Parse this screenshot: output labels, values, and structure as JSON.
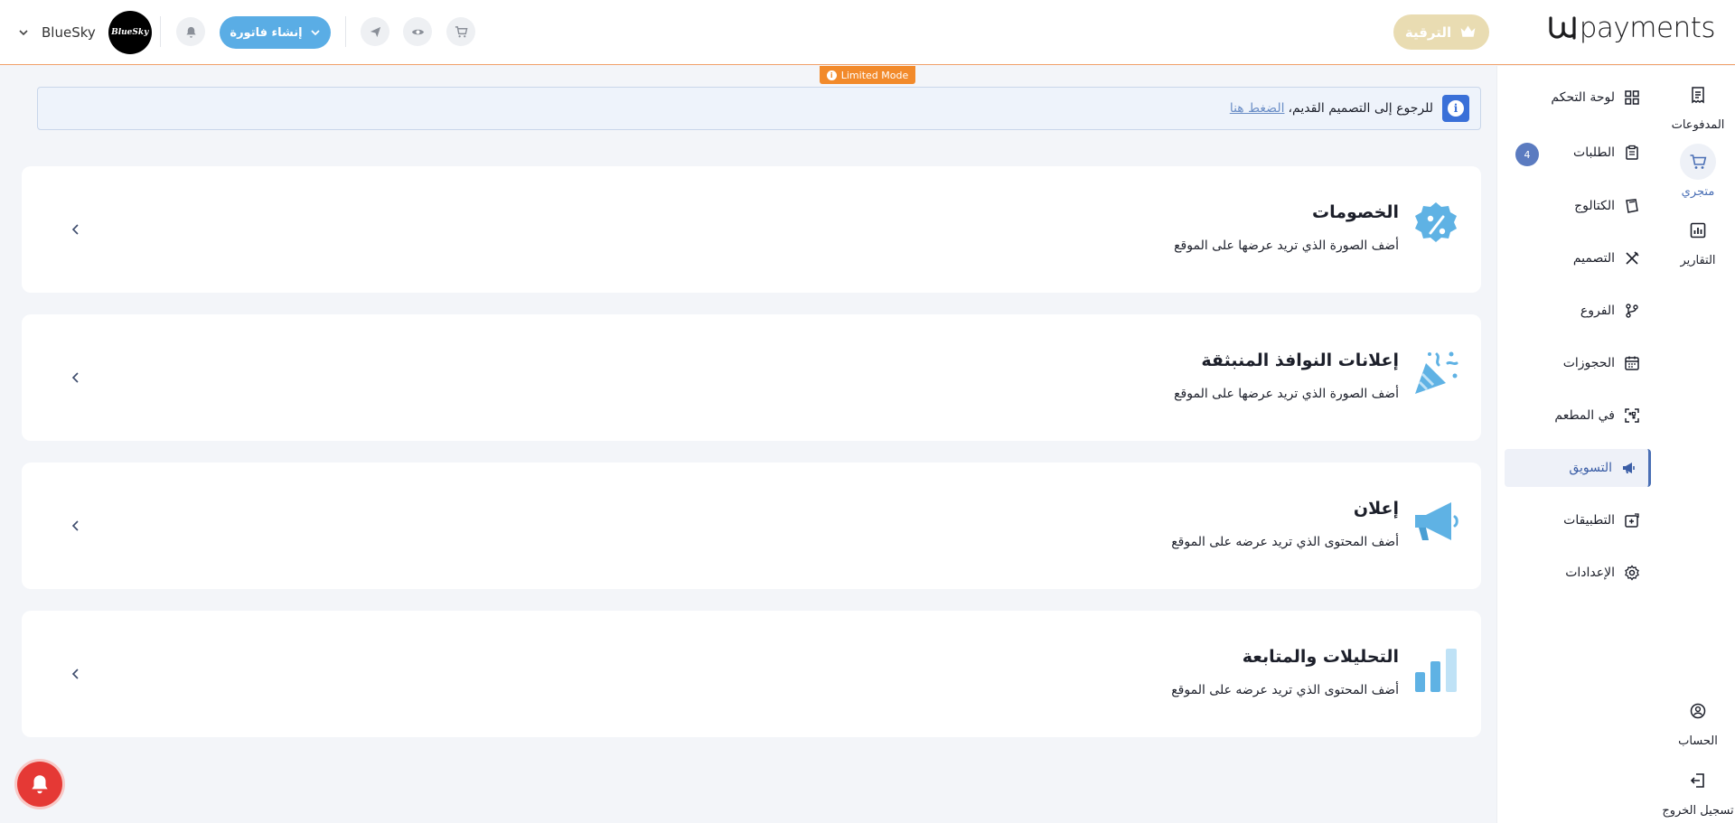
{
  "brand": {
    "logo_text": "payments"
  },
  "header": {
    "upgrade_label": "الترقية",
    "user_name": "BlueSky",
    "avatar_text": "BlueSky",
    "invoice_label": "إنشاء فاتورة",
    "limited_mode": "Limited Mode"
  },
  "rail": {
    "items": [
      {
        "label": "المدفوعات",
        "icon": "receipt-icon"
      },
      {
        "label": "متجري",
        "icon": "cart-icon"
      },
      {
        "label": "التقارير",
        "icon": "bar-chart-icon"
      },
      {
        "label": "الحساب",
        "icon": "account-icon"
      },
      {
        "label": "تسجيل الخروج",
        "icon": "logout-icon"
      }
    ]
  },
  "nav": {
    "items": [
      {
        "label": "لوحة التحكم",
        "icon": "grid-icon"
      },
      {
        "label": "الطلبات",
        "icon": "clipboard-icon",
        "badge": "4"
      },
      {
        "label": "الكتالوج",
        "icon": "catalog-icon"
      },
      {
        "label": "التصميم",
        "icon": "design-icon"
      },
      {
        "label": "الفروع",
        "icon": "branch-icon"
      },
      {
        "label": "الحجوزات",
        "icon": "calendar-icon"
      },
      {
        "label": "في المطعم",
        "icon": "qr-icon"
      },
      {
        "label": "التسويق",
        "icon": "megaphone-icon",
        "active": true
      },
      {
        "label": "التطبيقات",
        "icon": "apps-icon"
      },
      {
        "label": "الإعدادات",
        "icon": "settings-icon"
      }
    ]
  },
  "banner": {
    "text": "للرجوع إلى التصميم القديم،",
    "link": "الضغط هنا"
  },
  "cards": [
    {
      "title": "الخصومات",
      "desc": "أضف الصورة الذي تريد عرضها على الموقع",
      "icon": "discount-badge-icon"
    },
    {
      "title": "إعلانات النوافذ المنبثقة",
      "desc": "أضف الصورة الذي تريد عرضها على الموقع",
      "icon": "party-popper-icon"
    },
    {
      "title": "إعلان",
      "desc": "أضف المحتوى الذي تريد عرضه على الموقع",
      "icon": "megaphone-large-icon"
    },
    {
      "title": "التحليلات والمتابعة",
      "desc": "أضف المحتوى الذي تريد عرضه على الموقع",
      "icon": "analytics-bars-icon"
    }
  ],
  "colors": {
    "accent": "#5aade5",
    "upgrade": "#e9dcb2",
    "limited": "#f28a2b",
    "active_nav": "#4a6fb5",
    "alert": "#e53935"
  }
}
